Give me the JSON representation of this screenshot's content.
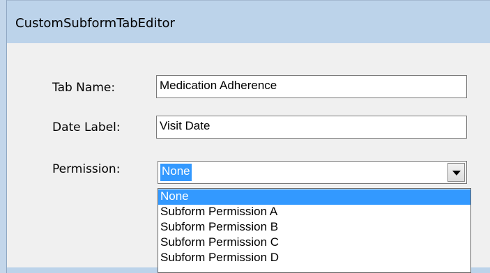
{
  "window": {
    "title": "CustomSubformTabEditor"
  },
  "form": {
    "tab_name_label": "Tab Name:",
    "tab_name_value": "Medication Adherence",
    "date_label_label": "Date Label:",
    "date_label_value": "Visit Date",
    "permission_label": "Permission:",
    "permission_value": "None"
  },
  "dropdown": {
    "options": [
      "None",
      "Subform Permission A",
      "Subform Permission B",
      "Subform Permission C",
      "Subform Permission D"
    ],
    "selected_index": 0
  },
  "colors": {
    "selection": "#3399ff",
    "titlebar": "#bcd3ea",
    "client": "#f0f0f0"
  },
  "icons": {
    "combo_button": "chevron-down-icon"
  }
}
